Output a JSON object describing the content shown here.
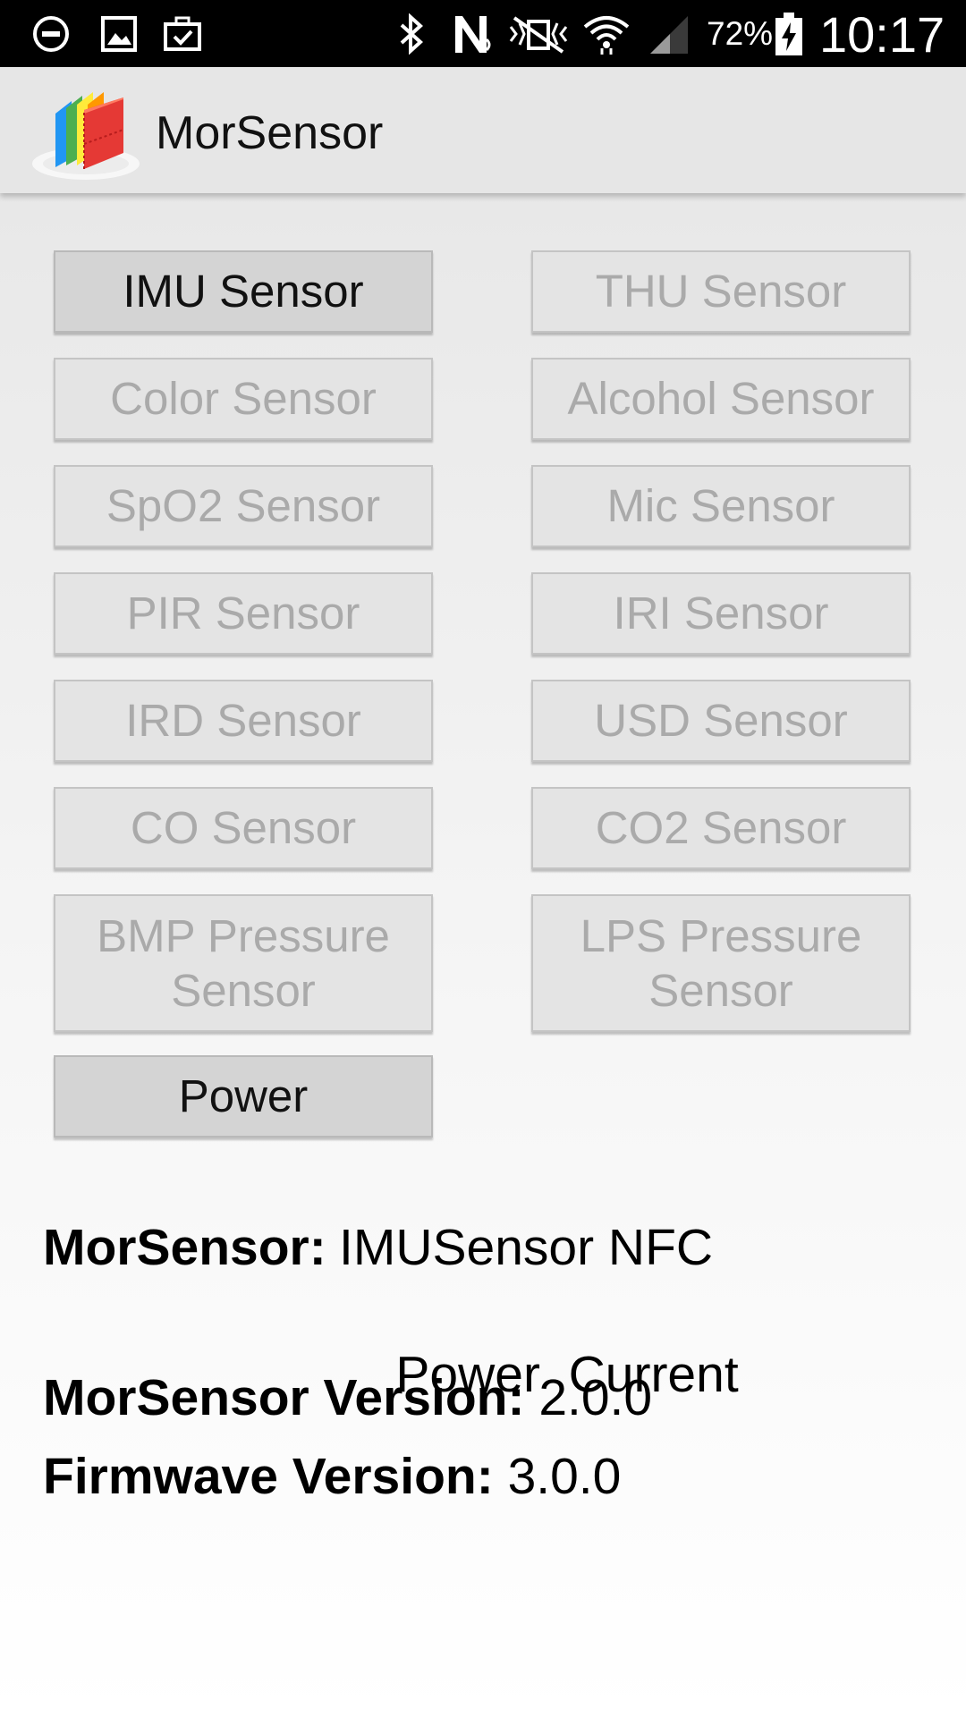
{
  "status_bar": {
    "icons": [
      "minus-circle-icon",
      "image-icon",
      "briefcase-check-icon",
      "bluetooth-icon",
      "nfc-icon",
      "vibrate-mute-icon",
      "wifi-icon",
      "cell-signal-icon",
      "battery-charging-icon"
    ],
    "battery_percent": "72%",
    "time": "10:17"
  },
  "app_bar": {
    "title": "MorSensor",
    "logo_colors": [
      "#2196f3",
      "#4caf50",
      "#ffeb3b",
      "#ff9800",
      "#e53935"
    ]
  },
  "sensors": {
    "imu": "IMU Sensor",
    "thu": "THU Sensor",
    "color": "Color Sensor",
    "alcohol": "Alcohol Sensor",
    "spo2": "SpO2 Sensor",
    "mic": "Mic Sensor",
    "pir": "PIR Sensor",
    "iri": "IRI Sensor",
    "ird": "IRD Sensor",
    "usd": "USD Sensor",
    "co": "CO Sensor",
    "co2": "CO2 Sensor",
    "bmp_line1": "BMP Pressure",
    "bmp_line2": "Sensor",
    "lps_line1": "LPS Pressure",
    "lps_line2": "Sensor"
  },
  "power_button": "Power",
  "info": {
    "morsensor_label": "MorSensor:",
    "morsensor_value_line1": "IMUSensor NFC",
    "morsensor_value_line2": "Power  Current",
    "version_label": "MorSensor Version:",
    "version_value": "2.0.0",
    "firmware_label": "Firmwave Version:",
    "firmware_value": "3.0.0"
  },
  "colors": {
    "enabled_button_text": "#111111",
    "disabled_button_text": "#aaaaaa",
    "button_background": "#e4e4e4",
    "action_bar_background": "#e6e6e6",
    "status_bar_background": "#000000"
  }
}
